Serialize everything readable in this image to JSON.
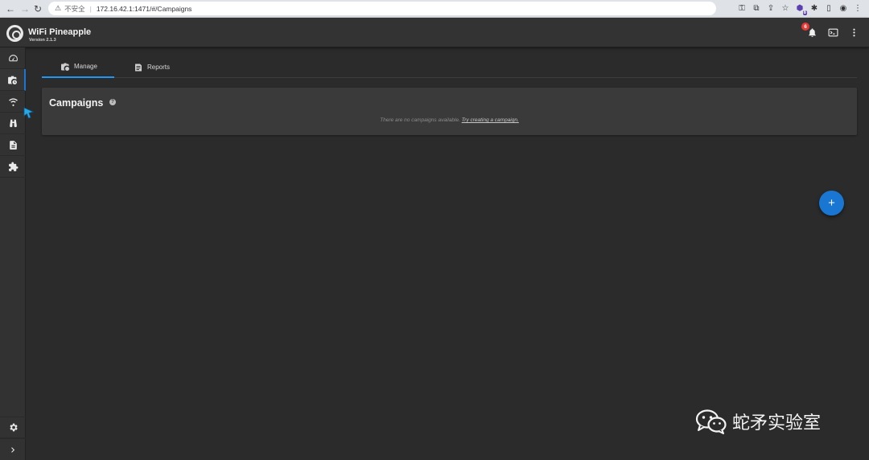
{
  "browser": {
    "url": "172.16.42.1:1471/#/Campaigns",
    "security_label": "不安全",
    "extension_badge": "8"
  },
  "header": {
    "title": "WiFi Pineapple",
    "version": "Version 2.1.3",
    "notification_count": "6"
  },
  "sidebar": {
    "items": [
      {
        "name": "dashboard",
        "icon": "speedometer-icon"
      },
      {
        "name": "campaigns",
        "icon": "briefcase-clock-icon",
        "active": true
      },
      {
        "name": "pineap",
        "icon": "wifi-icon"
      },
      {
        "name": "recon",
        "icon": "binoculars-icon"
      },
      {
        "name": "logging",
        "icon": "document-icon"
      },
      {
        "name": "modules",
        "icon": "puzzle-icon"
      }
    ],
    "settings_icon": "gear-icon",
    "expand_icon": "chevron-right-icon"
  },
  "tabs": [
    {
      "label": "Manage",
      "active": true
    },
    {
      "label": "Reports",
      "active": false
    }
  ],
  "campaigns": {
    "title": "Campaigns",
    "empty_text": "There are no campaigns available.",
    "create_link": "Try creating a campaign."
  },
  "fab": {
    "label": "+"
  },
  "watermark": {
    "text": "蛇矛实验室"
  },
  "colors": {
    "accent": "#1976d2",
    "background": "#2b2b2b",
    "surface": "#3a3a3a",
    "badge": "#e53935"
  }
}
